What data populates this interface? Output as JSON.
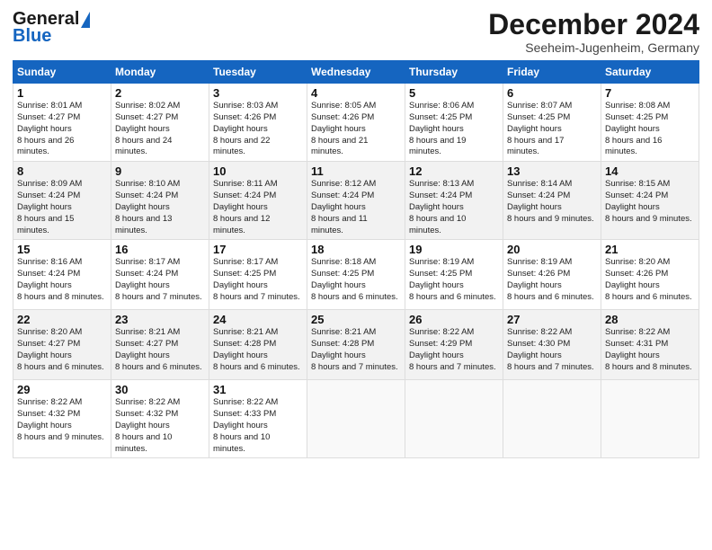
{
  "header": {
    "logo_general": "General",
    "logo_blue": "Blue",
    "month_title": "December 2024",
    "location": "Seeheim-Jugenheim, Germany"
  },
  "days_of_week": [
    "Sunday",
    "Monday",
    "Tuesday",
    "Wednesday",
    "Thursday",
    "Friday",
    "Saturday"
  ],
  "weeks": [
    [
      {
        "day": 1,
        "sunrise": "8:01 AM",
        "sunset": "4:27 PM",
        "daylight": "8 hours and 26 minutes."
      },
      {
        "day": 2,
        "sunrise": "8:02 AM",
        "sunset": "4:27 PM",
        "daylight": "8 hours and 24 minutes."
      },
      {
        "day": 3,
        "sunrise": "8:03 AM",
        "sunset": "4:26 PM",
        "daylight": "8 hours and 22 minutes."
      },
      {
        "day": 4,
        "sunrise": "8:05 AM",
        "sunset": "4:26 PM",
        "daylight": "8 hours and 21 minutes."
      },
      {
        "day": 5,
        "sunrise": "8:06 AM",
        "sunset": "4:25 PM",
        "daylight": "8 hours and 19 minutes."
      },
      {
        "day": 6,
        "sunrise": "8:07 AM",
        "sunset": "4:25 PM",
        "daylight": "8 hours and 17 minutes."
      },
      {
        "day": 7,
        "sunrise": "8:08 AM",
        "sunset": "4:25 PM",
        "daylight": "8 hours and 16 minutes."
      }
    ],
    [
      {
        "day": 8,
        "sunrise": "8:09 AM",
        "sunset": "4:24 PM",
        "daylight": "8 hours and 15 minutes."
      },
      {
        "day": 9,
        "sunrise": "8:10 AM",
        "sunset": "4:24 PM",
        "daylight": "8 hours and 13 minutes."
      },
      {
        "day": 10,
        "sunrise": "8:11 AM",
        "sunset": "4:24 PM",
        "daylight": "8 hours and 12 minutes."
      },
      {
        "day": 11,
        "sunrise": "8:12 AM",
        "sunset": "4:24 PM",
        "daylight": "8 hours and 11 minutes."
      },
      {
        "day": 12,
        "sunrise": "8:13 AM",
        "sunset": "4:24 PM",
        "daylight": "8 hours and 10 minutes."
      },
      {
        "day": 13,
        "sunrise": "8:14 AM",
        "sunset": "4:24 PM",
        "daylight": "8 hours and 9 minutes."
      },
      {
        "day": 14,
        "sunrise": "8:15 AM",
        "sunset": "4:24 PM",
        "daylight": "8 hours and 9 minutes."
      }
    ],
    [
      {
        "day": 15,
        "sunrise": "8:16 AM",
        "sunset": "4:24 PM",
        "daylight": "8 hours and 8 minutes."
      },
      {
        "day": 16,
        "sunrise": "8:17 AM",
        "sunset": "4:24 PM",
        "daylight": "8 hours and 7 minutes."
      },
      {
        "day": 17,
        "sunrise": "8:17 AM",
        "sunset": "4:25 PM",
        "daylight": "8 hours and 7 minutes."
      },
      {
        "day": 18,
        "sunrise": "8:18 AM",
        "sunset": "4:25 PM",
        "daylight": "8 hours and 6 minutes."
      },
      {
        "day": 19,
        "sunrise": "8:19 AM",
        "sunset": "4:25 PM",
        "daylight": "8 hours and 6 minutes."
      },
      {
        "day": 20,
        "sunrise": "8:19 AM",
        "sunset": "4:26 PM",
        "daylight": "8 hours and 6 minutes."
      },
      {
        "day": 21,
        "sunrise": "8:20 AM",
        "sunset": "4:26 PM",
        "daylight": "8 hours and 6 minutes."
      }
    ],
    [
      {
        "day": 22,
        "sunrise": "8:20 AM",
        "sunset": "4:27 PM",
        "daylight": "8 hours and 6 minutes."
      },
      {
        "day": 23,
        "sunrise": "8:21 AM",
        "sunset": "4:27 PM",
        "daylight": "8 hours and 6 minutes."
      },
      {
        "day": 24,
        "sunrise": "8:21 AM",
        "sunset": "4:28 PM",
        "daylight": "8 hours and 6 minutes."
      },
      {
        "day": 25,
        "sunrise": "8:21 AM",
        "sunset": "4:28 PM",
        "daylight": "8 hours and 7 minutes."
      },
      {
        "day": 26,
        "sunrise": "8:22 AM",
        "sunset": "4:29 PM",
        "daylight": "8 hours and 7 minutes."
      },
      {
        "day": 27,
        "sunrise": "8:22 AM",
        "sunset": "4:30 PM",
        "daylight": "8 hours and 7 minutes."
      },
      {
        "day": 28,
        "sunrise": "8:22 AM",
        "sunset": "4:31 PM",
        "daylight": "8 hours and 8 minutes."
      }
    ],
    [
      {
        "day": 29,
        "sunrise": "8:22 AM",
        "sunset": "4:32 PM",
        "daylight": "8 hours and 9 minutes."
      },
      {
        "day": 30,
        "sunrise": "8:22 AM",
        "sunset": "4:32 PM",
        "daylight": "8 hours and 10 minutes."
      },
      {
        "day": 31,
        "sunrise": "8:22 AM",
        "sunset": "4:33 PM",
        "daylight": "8 hours and 10 minutes."
      },
      null,
      null,
      null,
      null
    ]
  ]
}
